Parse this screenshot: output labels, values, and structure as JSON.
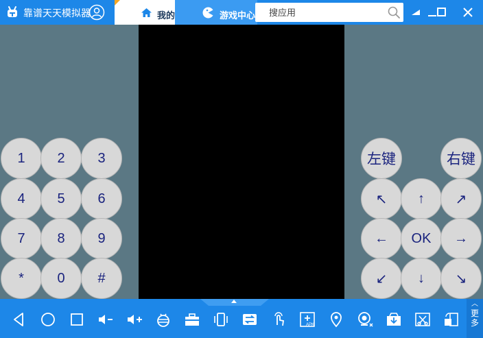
{
  "titlebar": {
    "app_title": "靠谱天天模拟器",
    "tabs": [
      {
        "label": "我的"
      },
      {
        "label": "游戏中心"
      }
    ],
    "search": {
      "placeholder": "搜应用",
      "value": ""
    }
  },
  "keypad": {
    "keys": [
      "1",
      "2",
      "3",
      "4",
      "5",
      "6",
      "7",
      "8",
      "9",
      "*",
      "0",
      "#"
    ]
  },
  "direction_pad": {
    "left_click": "左键",
    "right_click": "右键",
    "keys": [
      "↖",
      "↑",
      "↗",
      "←",
      "OK",
      "→",
      "↙",
      "↓",
      "↘"
    ]
  },
  "toolbar": {
    "more_label": "更多",
    "icons": [
      "back-icon",
      "home-icon",
      "recent-apps-icon",
      "volume-down-icon",
      "volume-up-icon",
      "bee-icon",
      "toolbox-icon",
      "shake-icon",
      "switch-icon",
      "touch-icon",
      "add-apk-icon",
      "location-icon",
      "camera-icon",
      "install-icon",
      "screenshot-icon",
      "rotate-icon"
    ],
    "apk_label": "APK"
  },
  "colors": {
    "accent": "#1d87e8",
    "background": "#5b7884",
    "key": "#d8d8d8",
    "key_text": "#1a237e"
  }
}
